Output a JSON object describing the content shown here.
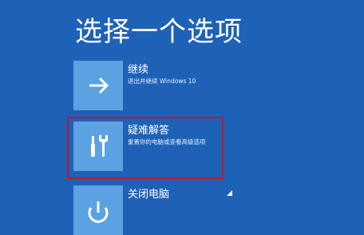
{
  "page": {
    "title": "选择一个选项",
    "background_color": "#1e62b8",
    "highlight_color": "#c0182a"
  },
  "options": [
    {
      "label": "继续",
      "description": "退出并继续 Windows 10",
      "icon": "arrow-right-icon"
    },
    {
      "label": "疑难解答",
      "description": "重置你的电脑或查看高级选项",
      "icon": "tools-icon"
    },
    {
      "label": "关闭电脑",
      "description": "",
      "icon": "power-icon"
    }
  ]
}
